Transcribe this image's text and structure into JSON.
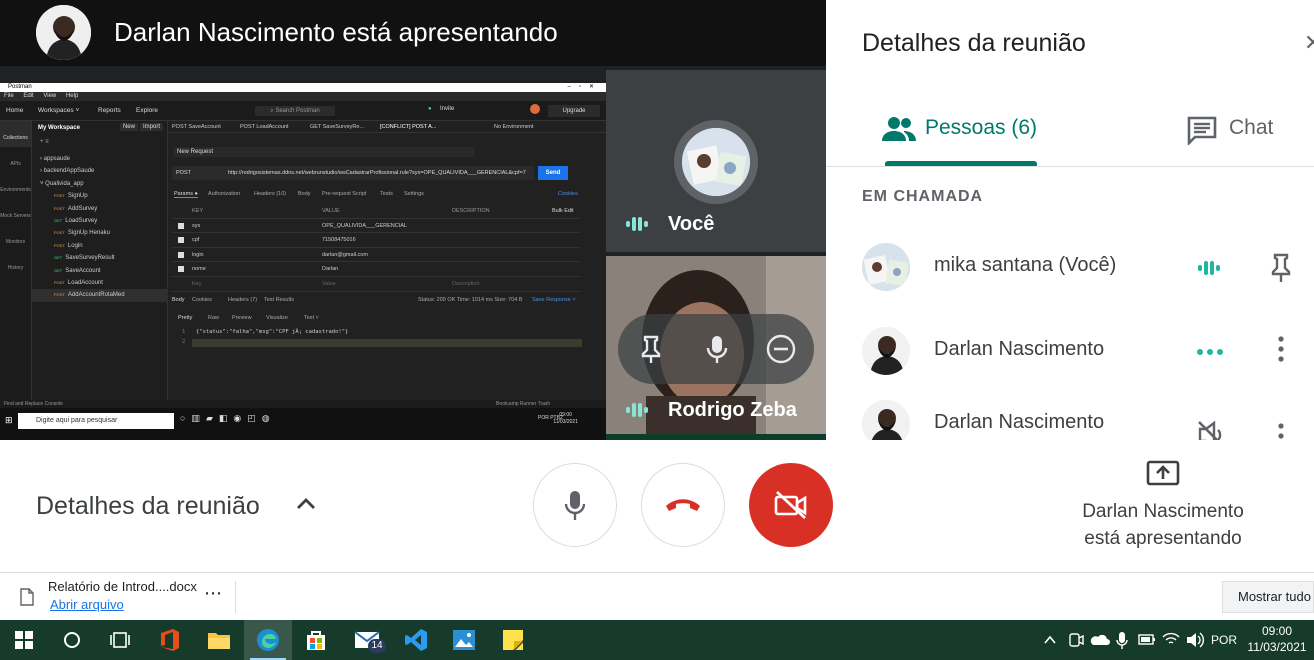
{
  "meet": {
    "presenter_banner": "Darlan Nascimento está apresentando",
    "tiles": {
      "you_label": "Você",
      "rodrigo_label": "Rodrigo Zeba"
    },
    "panel": {
      "title": "Detalhes da reunião",
      "tab_people": "Pessoas (6)",
      "tab_chat": "Chat",
      "section_in_call": "EM CHAMADA",
      "participants": [
        {
          "name": "mika santana (Você)"
        },
        {
          "name": "Darlan Nascimento"
        },
        {
          "name": "Darlan Nascimento"
        }
      ]
    },
    "controls": {
      "details_label": "Detalhes da reunião",
      "presenting_line1": "Darlan Nascimento",
      "presenting_line2": "está apresentando"
    },
    "colors": {
      "accent": "#00796b",
      "hangup_red": "#d93025",
      "speaking_teal": "#8ae6d4"
    }
  },
  "shared_screen": {
    "app_title": "Postman",
    "menu": [
      "File",
      "Edit",
      "View",
      "Help"
    ],
    "nav": [
      "Home",
      "Workspaces ˅",
      "Reports",
      "Explore"
    ],
    "search_placeholder": "Search Postman",
    "invite_label": "Invite",
    "upgrade_label": "Upgrade",
    "workspace": "My Workspace",
    "ws_new": "New",
    "ws_import": "Import",
    "left_strip": [
      "Collections",
      "APIs",
      "Environments",
      "Mock Servers",
      "Monitors",
      "History"
    ],
    "tree": [
      {
        "method": "",
        "label": "› appsaude"
      },
      {
        "method": "",
        "label": "› backendAppSaude"
      },
      {
        "method": "",
        "label": "˅ Qualivida_app"
      },
      {
        "method": "POST",
        "label": "SignUp"
      },
      {
        "method": "POST",
        "label": "AddSurvey"
      },
      {
        "method": "GET",
        "label": "LoadSurvey"
      },
      {
        "method": "POST",
        "label": "SignUp Henaku"
      },
      {
        "method": "POST",
        "label": "Login"
      },
      {
        "method": "GET",
        "label": "SaveSurveyResult"
      },
      {
        "method": "GET",
        "label": "SaveAccount"
      },
      {
        "method": "POST",
        "label": "LoadAccount"
      },
      {
        "method": "POST",
        "label": "AddAccountRotaMed"
      }
    ],
    "tabs": [
      "POST SaveAccount",
      "POST LoadAccount",
      "GET SaveSurveyRe...",
      "[CONFLICT] POST A..."
    ],
    "env_label": "No Environment",
    "request_name": "New Request",
    "method": "POST",
    "url": "http://rodrigosistemas.ddns.net/webrunstudio/wsCadastrarProfissional.rule?sys=OPE_QUALIVIDA___GERENCIAL&cpf=7",
    "send_label": "Send",
    "request_tabs": [
      "Params ●",
      "Authorization",
      "Headers (10)",
      "Body",
      "Pre-request Script",
      "Tests",
      "Settings"
    ],
    "cookies_label": "Cookies",
    "params_header": {
      "key": "KEY",
      "value": "VALUE",
      "description": "DESCRIPTION",
      "bulk": "Bulk Edit"
    },
    "params": [
      {
        "key": "sys",
        "value": "OPE_QUALIVIDA___GERENCIAL"
      },
      {
        "key": "cpf",
        "value": "71508475016"
      },
      {
        "key": "login",
        "value": "darlan@gmail.com"
      },
      {
        "key": "nome",
        "value": "Darlan"
      }
    ],
    "params_placeholder": {
      "key": "Key",
      "value": "Value",
      "description": "Description"
    },
    "response_tabs": [
      "Body",
      "Cookies",
      "Headers (7)",
      "Test Results"
    ],
    "response_status": "Status: 200 OK   Time: 1014 ms   Size: 704 B",
    "save_response": "Save Response ˅",
    "pretty_tabs": [
      "Pretty",
      "Raw",
      "Preview",
      "Visualize",
      "Text ˅"
    ],
    "json_line": "{\"status\":\"falha\",\"msg\":\"CPF jÃ¡ cadastrado!\"}",
    "status_bar": "Find and Replace    Console",
    "status_bar_right": "Bootcamp   Runner   Trash",
    "win_search": "Digite aqui para pesquisar",
    "win_lang": "POR PTB2",
    "win_time": "09:00",
    "win_date": "11/03/2021"
  },
  "download_bar": {
    "file_name": "Relatório de Introd....docx",
    "open_label": "Abrir arquivo",
    "show_all": "Mostrar tudo"
  },
  "taskbar": {
    "apps": [
      "start",
      "search",
      "task-view",
      "office",
      "file-explorer",
      "edge",
      "store",
      "mail",
      "vscode",
      "photos",
      "sticky-notes"
    ],
    "mail_badge": "14",
    "lang": "POR",
    "time": "09:00",
    "date": "11/03/2021"
  }
}
